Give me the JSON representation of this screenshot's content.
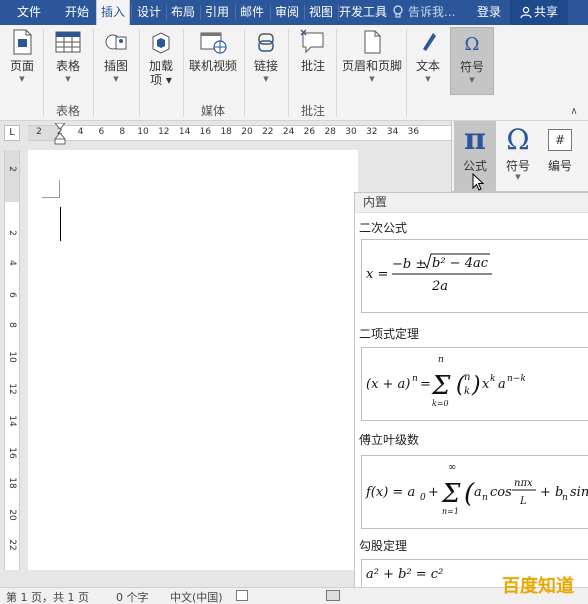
{
  "menu": {
    "tabs": [
      "文件",
      "开始",
      "插入",
      "设计",
      "布局",
      "引用",
      "邮件",
      "审阅",
      "视图",
      "开发工具"
    ],
    "active_tab": "插入",
    "tell_me": "告诉我...",
    "login": "登录",
    "share": "共享"
  },
  "ribbon": {
    "page": "页面",
    "table": "表格",
    "illustrations": "插图",
    "addins": "加载项",
    "online_video": "联机视频",
    "link": "链接",
    "comment": "批注",
    "header_footer": "页眉和页脚",
    "text": "文本",
    "symbols": "符号",
    "groups": {
      "table": "表格",
      "media": "媒体",
      "comments": "批注"
    }
  },
  "symbol_panel": {
    "equation": "公式",
    "symbol": "符号",
    "number": "编号",
    "pi_glyph": "π",
    "omega_glyph": "Ω",
    "hash_glyph": "#"
  },
  "ruler": {
    "corner": "L",
    "h_numbers": [
      "2",
      "2",
      "4",
      "6",
      "8",
      "10",
      "12",
      "14",
      "16",
      "18",
      "20",
      "22",
      "24",
      "26",
      "28",
      "30",
      "32",
      "34",
      "36"
    ],
    "v_numbers": [
      "2",
      "2",
      "4",
      "6",
      "8",
      "10",
      "12",
      "14",
      "16",
      "18",
      "20",
      "22"
    ]
  },
  "gallery": {
    "header": "内置",
    "items": [
      {
        "title": "二次公式",
        "formula": "x = (−b ± √(b² − 4ac)) / 2a"
      },
      {
        "title": "二项式定理",
        "formula": "(x + a)ⁿ = Σ_{k=0}^{n} (n k) xᵏ aⁿ⁻ᵏ"
      },
      {
        "title": "傅立叶级数",
        "formula": "f(x) = a₀ + Σ_{n=1}^{∞} (aₙ cos(nπx/L) + bₙ sin"
      },
      {
        "title": "勾股定理",
        "formula": "a² + b² = c²"
      }
    ]
  },
  "status": {
    "page": "第 1 页，共 1 页",
    "words": "0 个字",
    "language": "中文(中国)"
  },
  "watermark": "百度知道"
}
